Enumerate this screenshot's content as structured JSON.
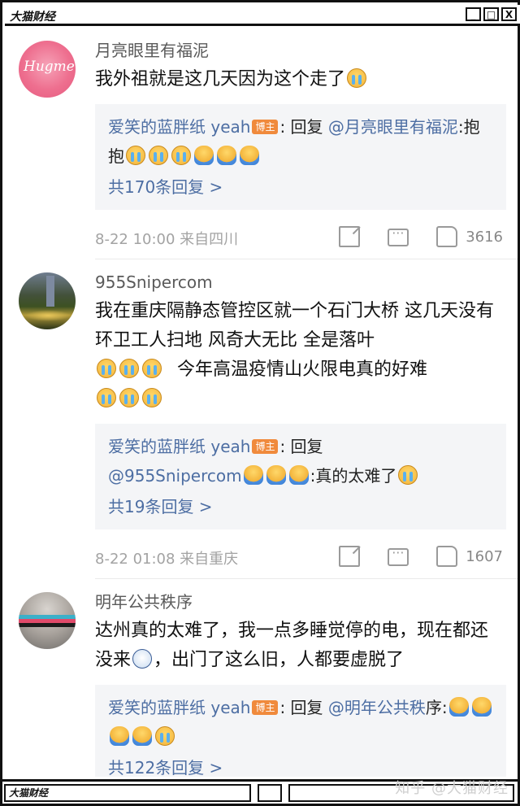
{
  "window": {
    "title": "大猫财经",
    "bottom_label": "大猫财经",
    "buttons": [
      "_",
      "□",
      "X"
    ]
  },
  "comments": [
    {
      "username": "月亮眼里有福泥",
      "avatar_text": "Hugme",
      "text": "我外祖就是这几天因为这个走了",
      "reply": {
        "author": "爱笑的蓝胖纸 yeah",
        "badge": "博主",
        "prefix": ": 回复 ",
        "mention": "@月亮眼里有福泥",
        "text": ":抱抱"
      },
      "reply_count": "共170条回复 >",
      "meta": "8-22 10:00 来自四川",
      "likes": "3616"
    },
    {
      "username": "955Snipercom",
      "text": "我在重庆隔静态管控区就一个石门大桥 这几天没有环卫工人扫地 风奇大无比 全是落叶",
      "text2": "今年高温疫情山火限电真的好难",
      "reply": {
        "author": "爱笑的蓝胖纸 yeah",
        "badge": "博主",
        "prefix": ": 回复",
        "mention": "@955Snipercom",
        "text": ":真的太难了"
      },
      "reply_count": "共19条回复 >",
      "meta": "8-22 01:08 来自重庆",
      "likes": "1607"
    },
    {
      "username": "明年公共秩序",
      "text": "达州真的太难了，我一点多睡觉停的电，现在都还没来",
      "text2": "，出门了这么旧，人都要虚脱了",
      "reply": {
        "author": "爱笑的蓝胖纸 yeah",
        "badge": "博主",
        "prefix": ": 回复 ",
        "mention": "@明年公共秩",
        "text": "序:"
      },
      "reply_count": "共122条回复 >"
    }
  ],
  "watermark": "知乎 @大猫财经",
  "icons": [
    "share-icon",
    "comment-icon",
    "like-icon",
    "crying-emoji",
    "hug-emoji",
    "shocked-emoji"
  ]
}
